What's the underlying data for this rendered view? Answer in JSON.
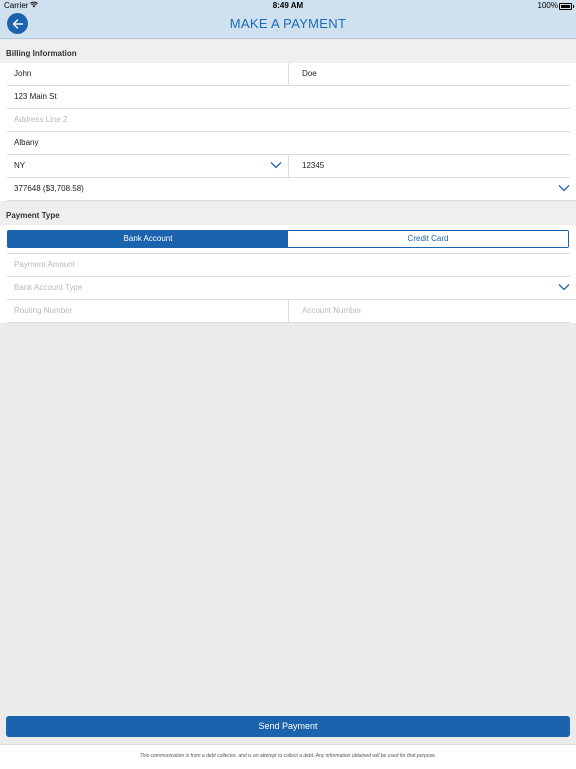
{
  "status_bar": {
    "carrier": "Carrier",
    "time": "8:49 AM",
    "battery": "100%"
  },
  "nav": {
    "title": "MAKE A PAYMENT",
    "back_icon": "arrow-left-icon"
  },
  "billing": {
    "header": "Billing Information",
    "first_name": "John",
    "last_name": "Doe",
    "address1": "123 Main St",
    "address2_placeholder": "Address Line 2",
    "city": "Albany",
    "state": "NY",
    "zip": "12345",
    "account": "377648 ($3,708.58)"
  },
  "payment": {
    "header": "Payment Type",
    "tabs": [
      "Bank Account",
      "Credit Card"
    ],
    "active_tab": "Bank Account",
    "amount_placeholder": "Payment Amount",
    "account_type_placeholder": "Bank Account Type",
    "routing_placeholder": "Routing Number",
    "account_number_placeholder": "Account Number"
  },
  "actions": {
    "send": "Send Payment"
  },
  "footer": {
    "disclaimer": "This communication is from a debt collector, and is an attempt to collect a debt.  Any information obtained will be used for that purpose."
  },
  "colors": {
    "primary": "#1b63ad",
    "nav_bg": "#cfe0ee",
    "title": "#1b6cb7",
    "background": "#ebebeb"
  }
}
